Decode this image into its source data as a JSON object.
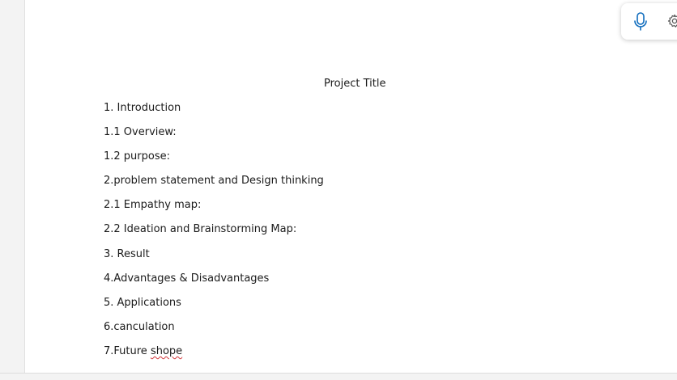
{
  "document": {
    "title": "Project Title",
    "lines": [
      {
        "text": "1. Introduction"
      },
      {
        "text": "1.1 Overview:"
      },
      {
        "text": "1.2 purpose:"
      },
      {
        "text": "2.problem statement and Design thinking"
      },
      {
        "text": "2.1 Empathy map:"
      },
      {
        "text": "2.2 Ideation and Brainstorming Map:"
      },
      {
        "text": "3. Result"
      },
      {
        "text": "4.Advantages & Disadvantages"
      },
      {
        "text": "5. Applications"
      },
      {
        "text": "6.canculation"
      },
      {
        "text_prefix": "7.Future ",
        "text_misspelled": "shope"
      }
    ]
  },
  "dictation": {
    "mic_icon": "microphone-icon",
    "settings_icon": "gear-icon",
    "accent_color": "#0f6cbd"
  },
  "status_bar": {
    "text": ""
  }
}
